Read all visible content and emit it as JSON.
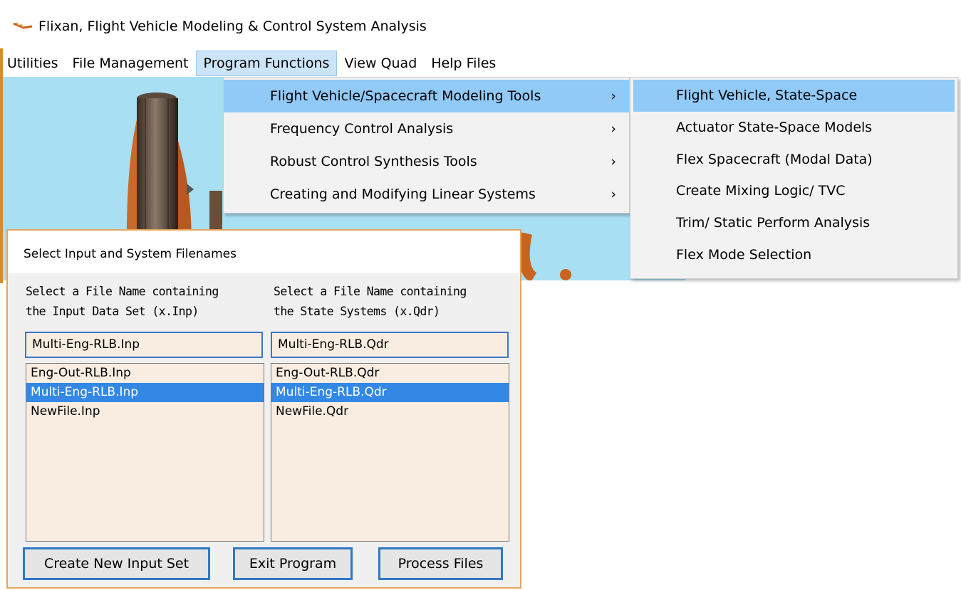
{
  "window": {
    "title": "Flixan, Flight Vehicle Modeling & Control System Analysis",
    "icon": "flixan-app-icon"
  },
  "menubar": {
    "items": [
      "Utilities",
      "File Management",
      "Program Functions",
      "View Quad",
      "Help Files"
    ],
    "active": "Program Functions"
  },
  "dropdown": {
    "items": [
      {
        "label": "Flight Vehicle/Spacecraft Modeling Tools",
        "arrow": "›"
      },
      {
        "label": "Frequency Control Analysis",
        "arrow": "›"
      },
      {
        "label": "Robust Control Synthesis Tools",
        "arrow": "›"
      },
      {
        "label": "Creating and Modifying Linear Systems",
        "arrow": "›"
      }
    ]
  },
  "submenu": {
    "items": [
      "Flight Vehicle, State-Space",
      "Actuator State-Space Models",
      "Flex Spacecraft (Modal Data)",
      "Create Mixing Logic/ TVC",
      "Trim/ Static Perform Analysis",
      "Flex Mode Selection"
    ]
  },
  "dialog": {
    "title": "Select Input and System Filenames",
    "left": {
      "caption_line1": "Select a File Name containing",
      "caption_line2": "the Input Data Set (x.Inp)",
      "selected_value": "Multi-Eng-RLB.Inp",
      "files": [
        "Eng-Out-RLB.Inp",
        "Multi-Eng-RLB.Inp",
        "NewFile.Inp"
      ]
    },
    "right": {
      "caption_line1": "Select a File Name containing",
      "caption_line2": "the State Systems (x.Qdr)",
      "selected_value": "Multi-Eng-RLB.Qdr",
      "files": [
        "Eng-Out-RLB.Qdr",
        "Multi-Eng-RLB.Qdr",
        "NewFile.Qdr"
      ]
    },
    "buttons": {
      "create": "Create New Input Set",
      "exit": "Exit Program",
      "process": "Process Files"
    }
  },
  "colors": {
    "background_sky": "#a8dff2",
    "menu_highlight": "#91c9f7",
    "selection": "#3388e6",
    "dialog_border": "#e8a45a"
  }
}
